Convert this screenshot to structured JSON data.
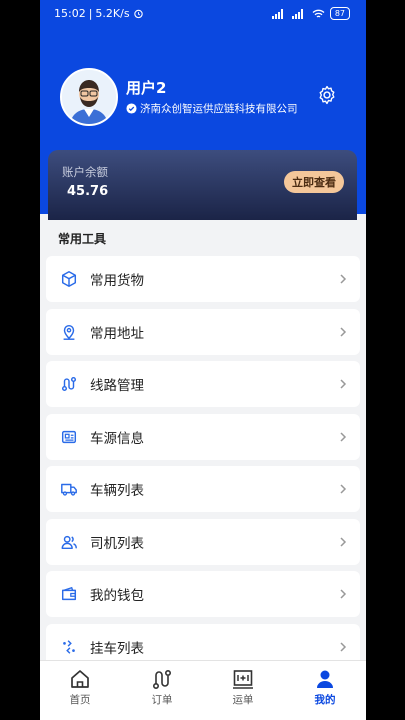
{
  "status": {
    "time": "15:02",
    "speed": "5.2K/s",
    "battery": "87"
  },
  "profile": {
    "username": "用户2",
    "company": "济南众创智运供应链科技有限公司"
  },
  "balance": {
    "label": "账户余额",
    "value": "45.76",
    "button": "立即查看"
  },
  "tools": {
    "title": "常用工具",
    "items": [
      {
        "label": "常用货物",
        "icon": "box-icon"
      },
      {
        "label": "常用地址",
        "icon": "location-pin-icon"
      },
      {
        "label": "线路管理",
        "icon": "route-icon"
      },
      {
        "label": "车源信息",
        "icon": "id-card-icon"
      },
      {
        "label": "车辆列表",
        "icon": "truck-icon"
      },
      {
        "label": "司机列表",
        "icon": "users-icon"
      },
      {
        "label": "我的钱包",
        "icon": "wallet-icon"
      },
      {
        "label": "挂车列表",
        "icon": "trailer-icon"
      }
    ]
  },
  "tabs": [
    {
      "label": "首页",
      "icon": "home-icon"
    },
    {
      "label": "订单",
      "icon": "order-route-icon"
    },
    {
      "label": "运单",
      "icon": "waybill-icon"
    },
    {
      "label": "我的",
      "icon": "person-icon",
      "active": true
    }
  ],
  "colors": {
    "primary": "#0b48e0",
    "accent_button": "#f4c79a",
    "card_dark": "#1b2447"
  }
}
